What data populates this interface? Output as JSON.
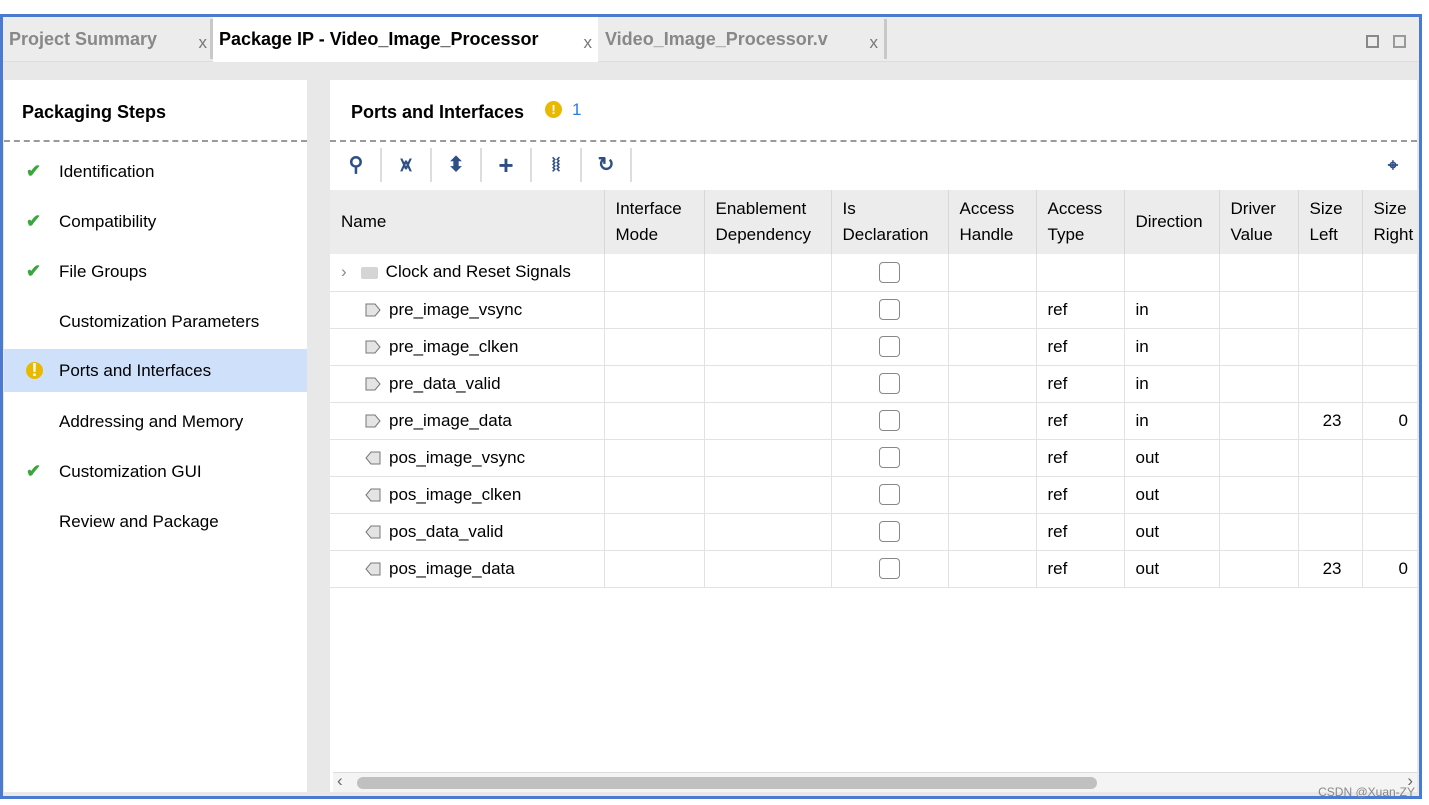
{
  "tabs": [
    {
      "label": "Project Summary",
      "close": "x",
      "active": false
    },
    {
      "label": "Package IP - Video_Image_Processor",
      "close": "x",
      "active": true
    },
    {
      "label": "Video_Image_Processor.v",
      "close": "x",
      "active": false
    }
  ],
  "left": {
    "title": "Packaging Steps",
    "steps": [
      {
        "label": "Identification",
        "status": "check"
      },
      {
        "label": "Compatibility",
        "status": "check"
      },
      {
        "label": "File Groups",
        "status": "check"
      },
      {
        "label": "Customization Parameters",
        "status": ""
      },
      {
        "label": "Ports and Interfaces",
        "status": "warning",
        "selected": true
      },
      {
        "label": "Addressing and Memory",
        "status": ""
      },
      {
        "label": "Customization GUI",
        "status": "check"
      },
      {
        "label": "Review and Package",
        "status": ""
      }
    ]
  },
  "main": {
    "title": "Ports and Interfaces",
    "warning_count": "1",
    "columns": [
      "Name",
      "Interface Mode",
      "Enablement Dependency",
      "Is Declaration",
      "Access Handle",
      "Access Type",
      "Direction",
      "Driver Value",
      "Size Left",
      "Size Right"
    ],
    "group": {
      "label": "Clock and Reset Signals"
    },
    "rows": [
      {
        "name": "pre_image_vsync",
        "type": "ref",
        "dir": "in",
        "left": "",
        "right": ""
      },
      {
        "name": "pre_image_clken",
        "type": "ref",
        "dir": "in",
        "left": "",
        "right": ""
      },
      {
        "name": "pre_data_valid",
        "type": "ref",
        "dir": "in",
        "left": "",
        "right": ""
      },
      {
        "name": "pre_image_data",
        "type": "ref",
        "dir": "in",
        "left": "23",
        "right": "0"
      },
      {
        "name": "pos_image_vsync",
        "type": "ref",
        "dir": "out",
        "left": "",
        "right": ""
      },
      {
        "name": "pos_image_clken",
        "type": "ref",
        "dir": "out",
        "left": "",
        "right": ""
      },
      {
        "name": "pos_data_valid",
        "type": "ref",
        "dir": "out",
        "left": "",
        "right": ""
      },
      {
        "name": "pos_image_data",
        "type": "ref",
        "dir": "out",
        "left": "23",
        "right": "0"
      }
    ]
  },
  "watermark": "CSDN @Xuan-ZY",
  "colors": {
    "frame": "#4a7bd0",
    "selected": "#cfe0fb",
    "check": "#3ca63c",
    "warning": "#e9b800",
    "toolbar_icon": "#2d4f86"
  }
}
